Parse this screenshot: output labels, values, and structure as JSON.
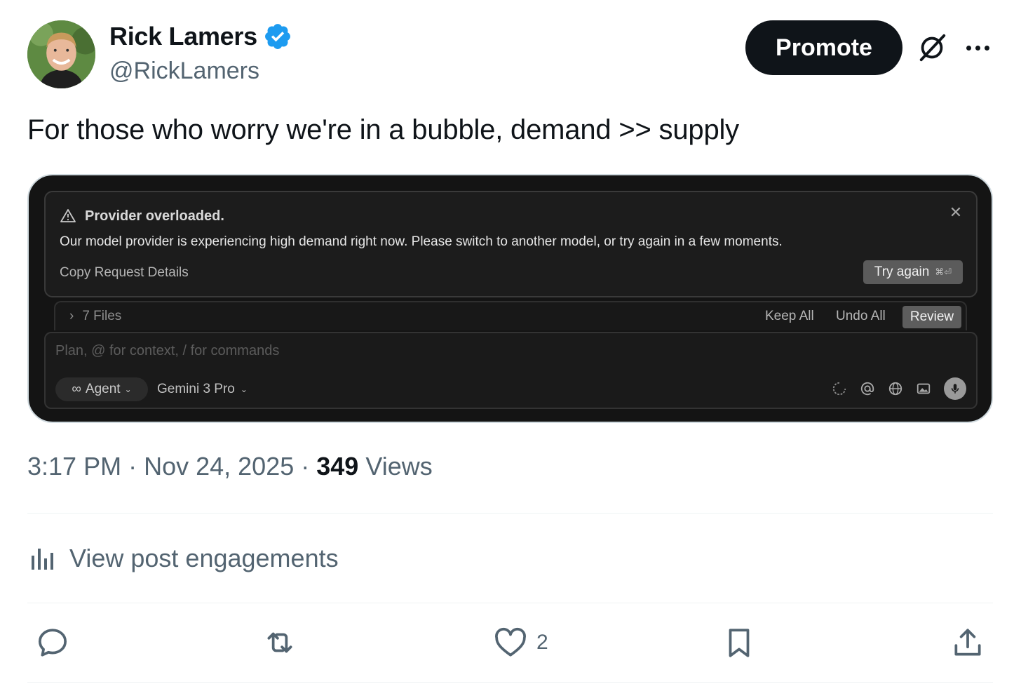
{
  "author": {
    "name": "Rick Lamers",
    "handle": "@RickLamers",
    "verified_color": "#1d9bf0"
  },
  "header": {
    "promote_label": "Promote",
    "icons": [
      "grok-icon",
      "more-icon"
    ]
  },
  "tweet": {
    "text": "For those who worry we're in a bubble, demand >> supply"
  },
  "media": {
    "error": {
      "title": "Provider overloaded.",
      "body": "Our model provider is experiencing high demand right now. Please switch to another model, or try again in a few moments.",
      "copy_details": "Copy Request Details",
      "try_again": "Try again",
      "try_again_shortcut": "⌘⏎"
    },
    "files": {
      "label": "7 Files",
      "keep_all": "Keep All",
      "undo_all": "Undo All",
      "review": "Review"
    },
    "input": {
      "placeholder": "Plan, @ for context, / for commands",
      "agent_label": "Agent",
      "model_label": "Gemini 3 Pro"
    }
  },
  "meta": {
    "time": "3:17 PM",
    "date": "Nov 24, 2025",
    "views_count": "349",
    "views_label": "Views"
  },
  "engagements_label": "View post engagements",
  "actions": {
    "like_count": "2"
  }
}
